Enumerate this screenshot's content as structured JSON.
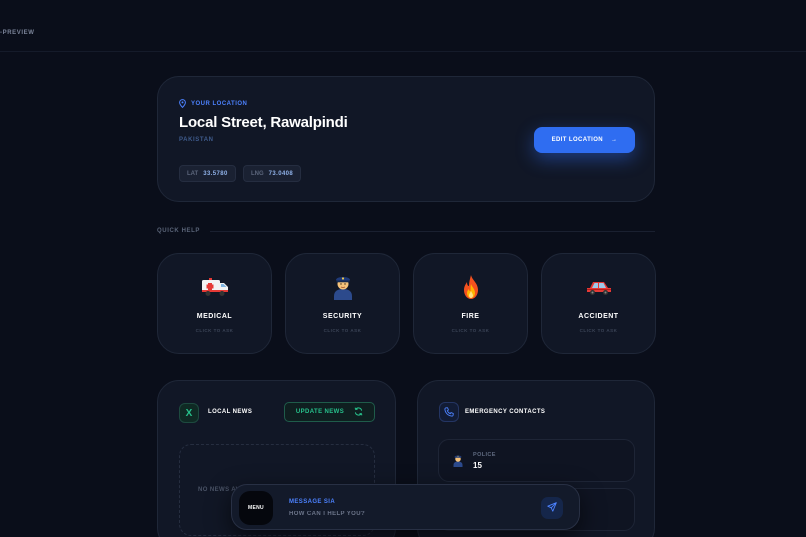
{
  "header": {
    "crumb": "-PREVIEW"
  },
  "location": {
    "label": "YOUR LOCATION",
    "title": "Local Street, Rawalpindi",
    "country": "PAKISTAN",
    "lat_key": "LAT",
    "lat_value": "33.5780",
    "lng_key": "LNG",
    "lng_value": "73.0408",
    "edit_label": "EDIT LOCATION",
    "edit_arrow": "→"
  },
  "quick_help": {
    "label": "QUICK HELP",
    "items": [
      {
        "title": "MEDICAL",
        "sub": "CLICK TO ASK",
        "icon": "ambulance-icon"
      },
      {
        "title": "SECURITY",
        "sub": "CLICK TO ASK",
        "icon": "police-officer-icon"
      },
      {
        "title": "FIRE",
        "sub": "CLICK TO ASK",
        "icon": "fire-icon"
      },
      {
        "title": "ACCIDENT",
        "sub": "CLICK TO ASK",
        "icon": "car-icon"
      }
    ]
  },
  "news": {
    "icon_glyph": "X",
    "title": "LOCAL NEWS",
    "update_label": "UPDATE NEWS",
    "empty_text": "NO NEWS AVAILABLE"
  },
  "contacts": {
    "title": "EMERGENCY CONTACTS",
    "items": [
      {
        "name": "POLICE",
        "number": "15"
      }
    ]
  },
  "message": {
    "menu_label": "MENU",
    "title": "MESSAGE SIA",
    "placeholder": "HOW CAN I HELP YOU?"
  },
  "colors": {
    "background": "#0a0e1a",
    "card": "#111726",
    "accent_blue": "#2f6df1",
    "accent_green": "#27c28c"
  }
}
